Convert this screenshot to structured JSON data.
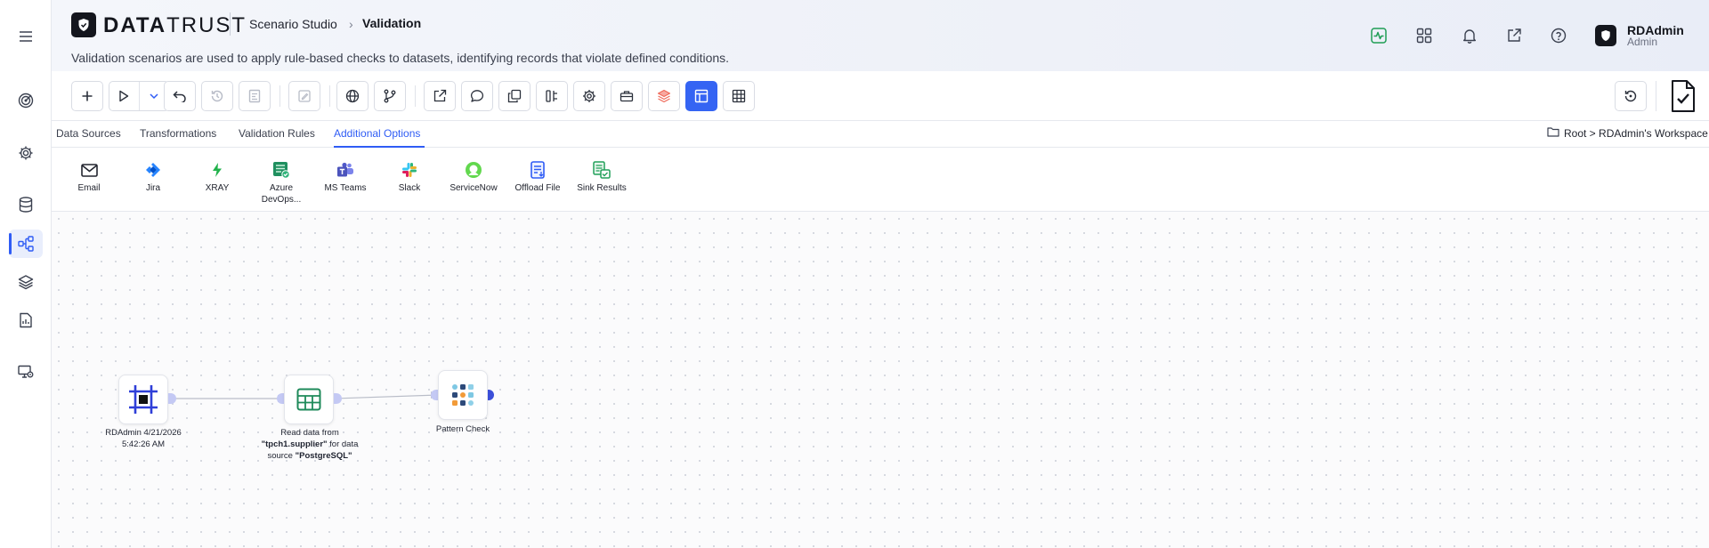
{
  "app": {
    "brand_bold": "DATA",
    "brand_rest": "TRUST",
    "breadcrumb_parent": "Scenario Studio",
    "breadcrumb_current": "Validation",
    "subtitle": "Validation scenarios are used to apply rule-based checks to datasets, identifying records that violate defined conditions."
  },
  "user": {
    "name": "RDAdmin",
    "role": "Admin"
  },
  "tabs": [
    {
      "label": "Data Sources"
    },
    {
      "label": "Transformations"
    },
    {
      "label": "Validation Rules"
    },
    {
      "label": "Additional Options"
    }
  ],
  "active_tab": "Additional Options",
  "workspace_path": "Root > RDAdmin's Workspace",
  "options": [
    {
      "label": "Email",
      "icon": "mail-icon"
    },
    {
      "label": "Jira",
      "icon": "jira-icon"
    },
    {
      "label": "XRAY",
      "icon": "xray-icon"
    },
    {
      "label": "Azure DevOps...",
      "icon": "azure-devops-icon"
    },
    {
      "label": "MS Teams",
      "icon": "ms-teams-icon"
    },
    {
      "label": "Slack",
      "icon": "slack-icon"
    },
    {
      "label": "ServiceNow",
      "icon": "servicenow-icon"
    },
    {
      "label": "Offload File",
      "icon": "offload-file-icon"
    },
    {
      "label": "Sink Results",
      "icon": "sink-results-icon"
    }
  ],
  "nodes": {
    "start": {
      "label": "RDAdmin 4/21/2026 5:42:26 AM"
    },
    "read": {
      "prefix": "Read data from ",
      "table": "\"tpch1.supplier\"",
      "middle": " for data source ",
      "source": "\"PostgreSQL\""
    },
    "check": {
      "label": "Pattern Check"
    }
  },
  "colors": {
    "accent": "#2f5cf5",
    "active_button": "#3564f3",
    "header_bg": "#eef1f8"
  }
}
